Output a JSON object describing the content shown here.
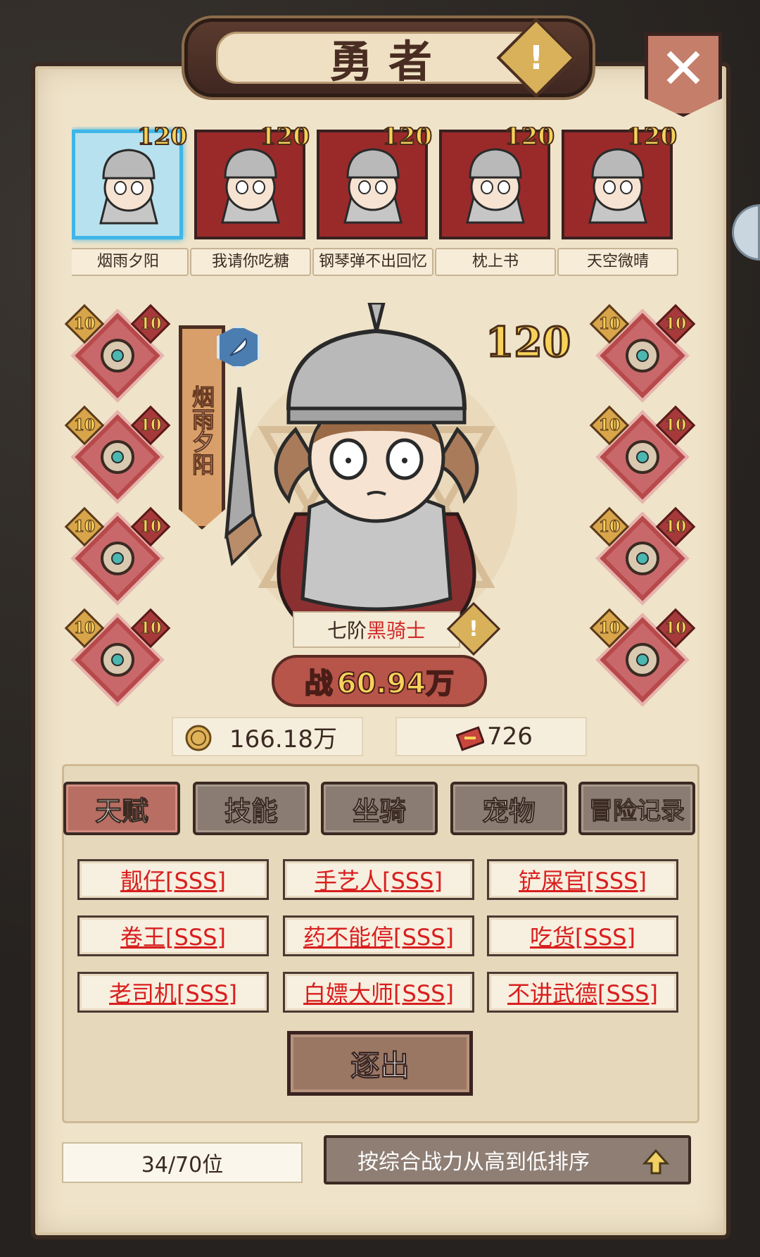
{
  "title": "勇者",
  "close_label": "✕",
  "warning_symbol": "!",
  "roster": [
    {
      "name": "烟雨夕阳",
      "level": "120",
      "selected": true
    },
    {
      "name": "我请你吃糖",
      "level": "120",
      "selected": false
    },
    {
      "name": "钢琴弹不出回忆",
      "level": "120",
      "selected": false
    },
    {
      "name": "枕上书",
      "level": "120",
      "selected": false
    },
    {
      "name": "天空微晴",
      "level": "120",
      "selected": false
    }
  ],
  "hero": {
    "name": "烟雨夕阳",
    "level": "120",
    "class_rank": "七阶",
    "class_name": "黑骑士",
    "power_label": "战",
    "power_value": "60.94万"
  },
  "equipment": {
    "left": [
      {
        "slot": "weapon",
        "icon": "staff-icon",
        "star": "10",
        "level": "10"
      },
      {
        "slot": "armor",
        "icon": "armor-icon",
        "star": "10",
        "level": "10"
      },
      {
        "slot": "helmet",
        "icon": "helmet-icon",
        "star": "10",
        "level": "10"
      },
      {
        "slot": "boots",
        "icon": "boots-icon",
        "star": "10",
        "level": "10"
      }
    ],
    "right": [
      {
        "slot": "necklace",
        "icon": "necklace-icon",
        "star": "10",
        "level": "10"
      },
      {
        "slot": "ring",
        "icon": "ring-icon",
        "star": "10",
        "level": "10"
      },
      {
        "slot": "shoulder",
        "icon": "shoulder-icon",
        "star": "10",
        "level": "10"
      },
      {
        "slot": "cloak",
        "icon": "cloak-icon",
        "star": "10",
        "level": "10"
      }
    ]
  },
  "stats": {
    "gold": "166.18万",
    "tickets": "726"
  },
  "tabs": [
    {
      "label": "天赋",
      "active": true
    },
    {
      "label": "技能",
      "active": false
    },
    {
      "label": "坐骑",
      "active": false
    },
    {
      "label": "宠物",
      "active": false
    },
    {
      "label": "冒险记录",
      "active": false
    }
  ],
  "talents": [
    "靓仔[SSS]",
    "手艺人[SSS]",
    "铲屎官[SSS]",
    "卷王[SSS]",
    "药不能停[SSS]",
    "吃货[SSS]",
    "老司机[SSS]",
    "白嫖大师[SSS]",
    "不讲武德[SSS]"
  ],
  "expel_label": "逐出",
  "count_label": "34/70位",
  "sort_label": "按综合战力从高到低排序",
  "colors": {
    "parchment": "#efe3c9",
    "active_tab": "#b86e62",
    "inactive_tab": "#8a7c72",
    "talent_text": "#d81f1f",
    "selected_border": "#3fb6e8"
  }
}
